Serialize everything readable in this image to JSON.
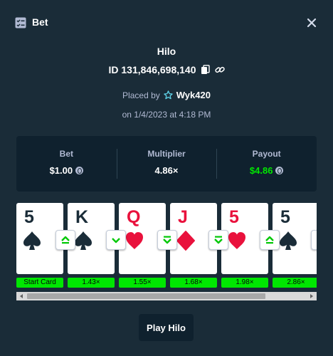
{
  "header": {
    "title": "Bet",
    "icon": "bet-slip-icon",
    "close_icon": "close-icon"
  },
  "game": {
    "name": "Hilo",
    "bet_id": "ID 131,846,698,140",
    "placed_by_label": "Placed by",
    "username": "Wyk420",
    "date": "on 1/4/2023 at 4:18 PM"
  },
  "stats": {
    "bet_label": "Bet",
    "bet_value": "$1.00",
    "multiplier_label": "Multiplier",
    "multiplier_value": "4.86×",
    "payout_label": "Payout",
    "payout_value": "$4.86"
  },
  "cards": [
    {
      "rank": "5",
      "suit": "spade",
      "color": "black",
      "multiplier": "Start Card"
    },
    {
      "rank": "K",
      "suit": "spade",
      "color": "black",
      "multiplier": "1.43×",
      "guess": "higher"
    },
    {
      "rank": "Q",
      "suit": "heart",
      "color": "red",
      "multiplier": "1.55×",
      "guess": "lower"
    },
    {
      "rank": "J",
      "suit": "diamond",
      "color": "red",
      "multiplier": "1.68×",
      "guess": "lower"
    },
    {
      "rank": "5",
      "suit": "heart",
      "color": "red",
      "multiplier": "1.98×",
      "guess": "lower"
    },
    {
      "rank": "5",
      "suit": "spade",
      "color": "black",
      "multiplier": "2.86×",
      "guess": "higher"
    }
  ],
  "play_button": "Play Hilo",
  "colors": {
    "accent_green": "#00e701",
    "card_red": "#e9113c",
    "panel": "#1a2c38",
    "panel_dark": "#0f212e"
  }
}
